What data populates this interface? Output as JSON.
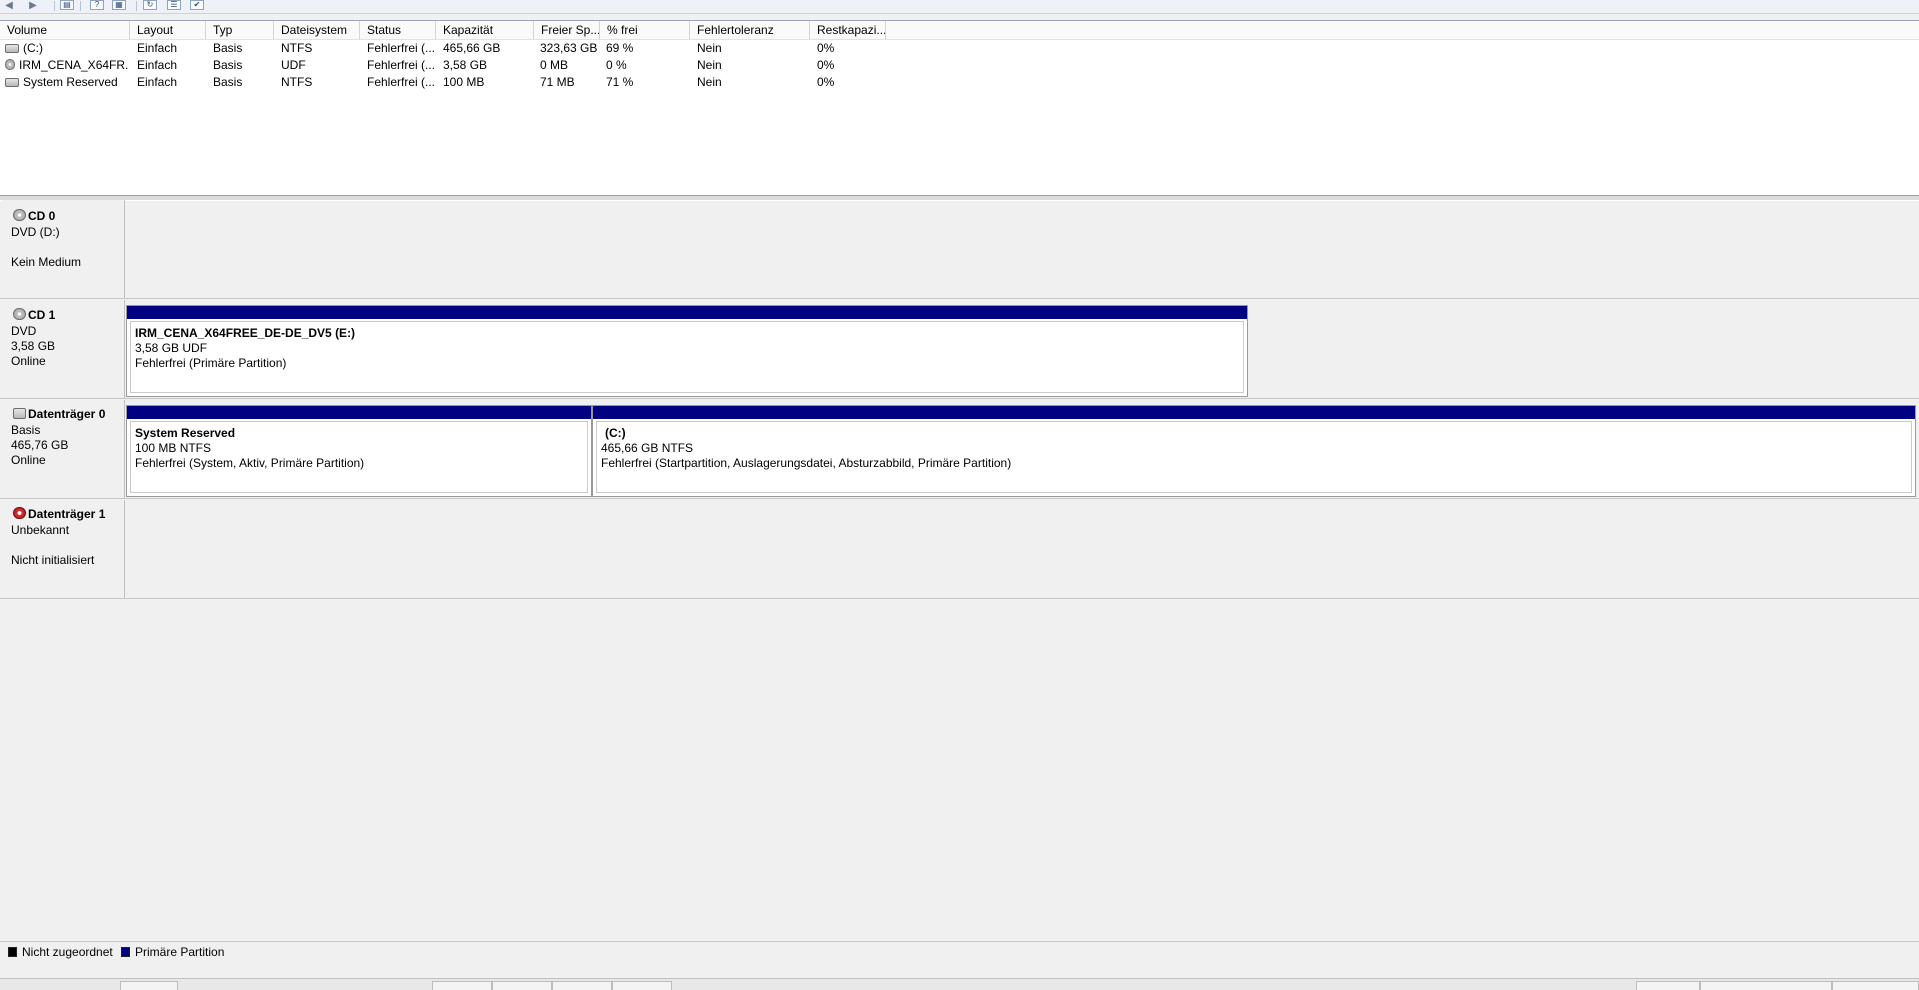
{
  "colors": {
    "primary_partition": "#000080",
    "unallocated": "#000000"
  },
  "toolbar": {
    "back_icon": "back-arrow-icon",
    "forward_icon": "forward-arrow-icon",
    "buttons": [
      "console-tree-icon",
      "help-icon",
      "show-hide-icon",
      "refresh-icon",
      "properties-icon",
      "export-list-icon"
    ]
  },
  "volume_list": {
    "headers": [
      "Volume",
      "Layout",
      "Typ",
      "Dateisystem",
      "Status",
      "Kapazität",
      "Freier Sp...",
      "% frei",
      "Fehlertoleranz",
      "Restkapazi..."
    ],
    "rows": [
      {
        "volume": "(C:)",
        "icon": "hard-disk-icon",
        "layout": "Einfach",
        "typ": "Basis",
        "dateisystem": "NTFS",
        "status": "Fehlerfrei (...",
        "kapazitaet": "465,66 GB",
        "frei": "323,63 GB",
        "prozent": "69 %",
        "fehlertoleranz": "Nein",
        "rest": "0%"
      },
      {
        "volume": "IRM_CENA_X64FR...",
        "icon": "cd-drive-icon",
        "layout": "Einfach",
        "typ": "Basis",
        "dateisystem": "UDF",
        "status": "Fehlerfrei (...",
        "kapazitaet": "3,58 GB",
        "frei": "0 MB",
        "prozent": "0 %",
        "fehlertoleranz": "Nein",
        "rest": "0%"
      },
      {
        "volume": "System Reserved",
        "icon": "hard-disk-icon",
        "layout": "Einfach",
        "typ": "Basis",
        "dateisystem": "NTFS",
        "status": "Fehlerfrei (...",
        "kapazitaet": "100 MB",
        "frei": "71 MB",
        "prozent": "71 %",
        "fehlertoleranz": "Nein",
        "rest": "0%"
      }
    ]
  },
  "disks": [
    {
      "name": "CD 0",
      "icon": "cd-drive-icon",
      "line1": "DVD (D:)",
      "line2": "",
      "line3": "Kein Medium"
    },
    {
      "name": "CD 1",
      "icon": "cd-drive-icon",
      "line1": "DVD",
      "line2": "3,58 GB",
      "line3": "Online",
      "partitions": [
        {
          "title": "IRM_CENA_X64FREE_DE-DE_DV5  (E:)",
          "size": "3,58 GB UDF",
          "status": "Fehlerfrei (Primäre Partition)"
        }
      ]
    },
    {
      "name": "Datenträger 0",
      "icon": "hard-disk-icon",
      "line1": "Basis",
      "line2": "465,76 GB",
      "line3": "Online",
      "partitions": [
        {
          "title": "System Reserved",
          "size": "100 MB NTFS",
          "status": "Fehlerfrei (System, Aktiv, Primäre Partition)"
        },
        {
          "title": "(C:)",
          "size": "465,66 GB NTFS",
          "status": "Fehlerfrei (Startpartition, Auslagerungsdatei, Absturzabbild, Primäre Partition)"
        }
      ]
    },
    {
      "name": "Datenträger 1",
      "icon": "disk-warning-icon",
      "line1": "Unbekannt",
      "line2": "",
      "line3": "Nicht initialisiert"
    }
  ],
  "legend": {
    "unallocated": "Nicht zugeordnet",
    "primary": "Primäre Partition"
  }
}
